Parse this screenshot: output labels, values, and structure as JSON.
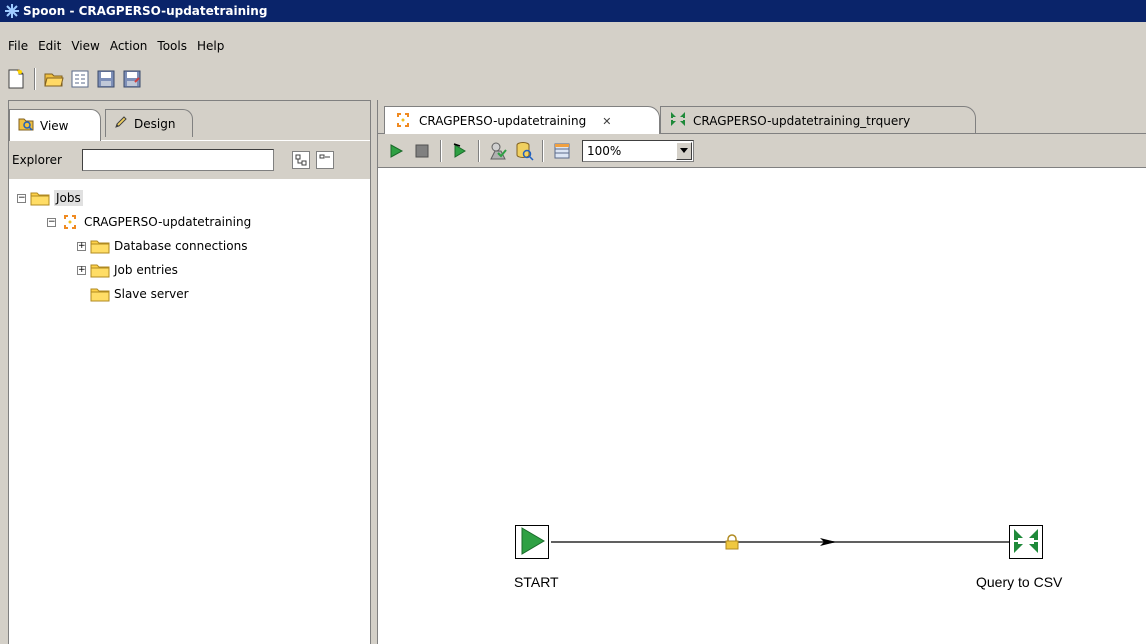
{
  "window": {
    "title": "Spoon - CRAGPERSO-updatetraining"
  },
  "menu": [
    "File",
    "Edit",
    "View",
    "Action",
    "Tools",
    "Help"
  ],
  "toolbar": {
    "icons": [
      "new-file-icon",
      "open-icon",
      "explore-repository-icon",
      "save-icon",
      "save-as-icon"
    ]
  },
  "left_panel": {
    "tabs": [
      {
        "label": "View",
        "icon": "view-icon",
        "active": true
      },
      {
        "label": "Design",
        "icon": "pencil-icon",
        "active": false
      }
    ],
    "explorer_label": "Explorer",
    "explorer_value": "",
    "tree": {
      "root": "Jobs",
      "job": "CRAGPERSO-updatetraining",
      "children": [
        "Database connections",
        "Job entries",
        "Slave server"
      ]
    }
  },
  "tabs": [
    {
      "label": "CRAGPERSO-updatetraining",
      "icon": "job-icon",
      "active": true,
      "closable": true
    },
    {
      "label": "CRAGPERSO-updatetraining_trquery",
      "icon": "transformation-icon",
      "active": false
    }
  ],
  "job_toolbar": {
    "icons": [
      "run-icon",
      "stop-icon",
      "replay-icon",
      "check-icon",
      "sql-icon",
      "show-results-icon"
    ],
    "zoom": "100%"
  },
  "canvas": {
    "entries": [
      {
        "label": "START",
        "icon": "start-icon"
      },
      {
        "label": "Query to CSV",
        "icon": "transformation-icon"
      }
    ]
  },
  "colors": {
    "titlebar": "#0a246a",
    "start_green": "#2ea043",
    "hop_green": "#1f8a3a",
    "lock": "#e8c53a"
  }
}
